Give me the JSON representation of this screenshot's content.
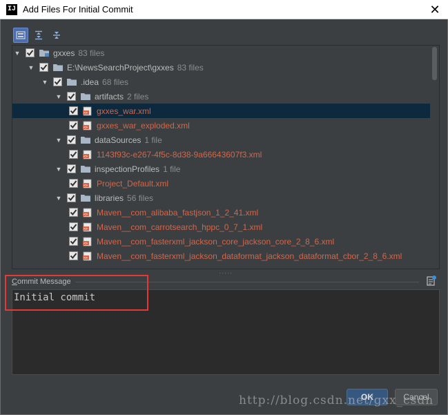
{
  "window": {
    "title": "Add Files For Initial Commit",
    "app_icon_text": "IJ",
    "close_symbol": "✕"
  },
  "toolbar": {
    "buttons": [
      {
        "name": "group-by-directory-icon",
        "active": true
      },
      {
        "name": "expand-all-icon",
        "active": false
      },
      {
        "name": "collapse-all-icon",
        "active": false
      }
    ]
  },
  "tree": {
    "rows": [
      {
        "label": "gxxes",
        "count": "83 files",
        "kind": "module",
        "expanded": true,
        "checked": true,
        "red": false,
        "selected": false
      },
      {
        "label": "E:\\NewsSearchProject\\gxxes",
        "count": "83 files",
        "kind": "folder",
        "expanded": true,
        "checked": true,
        "red": false,
        "selected": false
      },
      {
        "label": ".idea",
        "count": "68 files",
        "kind": "folder",
        "expanded": true,
        "checked": true,
        "red": false,
        "selected": false
      },
      {
        "label": "artifacts",
        "count": "2 files",
        "kind": "folder",
        "expanded": true,
        "checked": true,
        "red": false,
        "selected": false
      },
      {
        "label": "gxxes_war.xml",
        "count": "",
        "kind": "xml",
        "expanded": null,
        "checked": true,
        "red": true,
        "selected": true
      },
      {
        "label": "gxxes_war_exploded.xml",
        "count": "",
        "kind": "xml",
        "expanded": null,
        "checked": true,
        "red": true,
        "selected": false
      },
      {
        "label": "dataSources",
        "count": "1 file",
        "kind": "folder",
        "expanded": true,
        "checked": true,
        "red": false,
        "selected": false
      },
      {
        "label": "1143f93c-e267-4f5c-8d38-9a66643607f3.xml",
        "count": "",
        "kind": "xml",
        "expanded": null,
        "checked": true,
        "red": true,
        "selected": false
      },
      {
        "label": "inspectionProfiles",
        "count": "1 file",
        "kind": "folder",
        "expanded": true,
        "checked": true,
        "red": false,
        "selected": false
      },
      {
        "label": "Project_Default.xml",
        "count": "",
        "kind": "xml",
        "expanded": null,
        "checked": true,
        "red": true,
        "selected": false
      },
      {
        "label": "libraries",
        "count": "56 files",
        "kind": "folder",
        "expanded": true,
        "checked": true,
        "red": false,
        "selected": false
      },
      {
        "label": "Maven__com_alibaba_fastjson_1_2_41.xml",
        "count": "",
        "kind": "xml",
        "expanded": null,
        "checked": true,
        "red": true,
        "selected": false
      },
      {
        "label": "Maven__com_carrotsearch_hppc_0_7_1.xml",
        "count": "",
        "kind": "xml",
        "expanded": null,
        "checked": true,
        "red": true,
        "selected": false
      },
      {
        "label": "Maven__com_fasterxml_jackson_core_jackson_core_2_8_6.xml",
        "count": "",
        "kind": "xml",
        "expanded": null,
        "checked": true,
        "red": true,
        "selected": false
      },
      {
        "label": "Maven__com_fasterxml_jackson_dataformat_jackson_dataformat_cbor_2_8_6.xml",
        "count": "",
        "kind": "xml",
        "expanded": null,
        "checked": true,
        "red": true,
        "selected": false
      }
    ]
  },
  "commit": {
    "label_prefix": "C",
    "label_rest": "ommit Message",
    "message": "Initial commit"
  },
  "buttons": {
    "ok_label": "OK",
    "cancel_label": "Cancel"
  },
  "watermark": "http://blog.csdn.net/gxx_csdn",
  "colors": {
    "background": "#3c3f41",
    "selection": "#0d293e",
    "unversioned_file": "#d2664a",
    "highlight_box": "#e53935"
  }
}
